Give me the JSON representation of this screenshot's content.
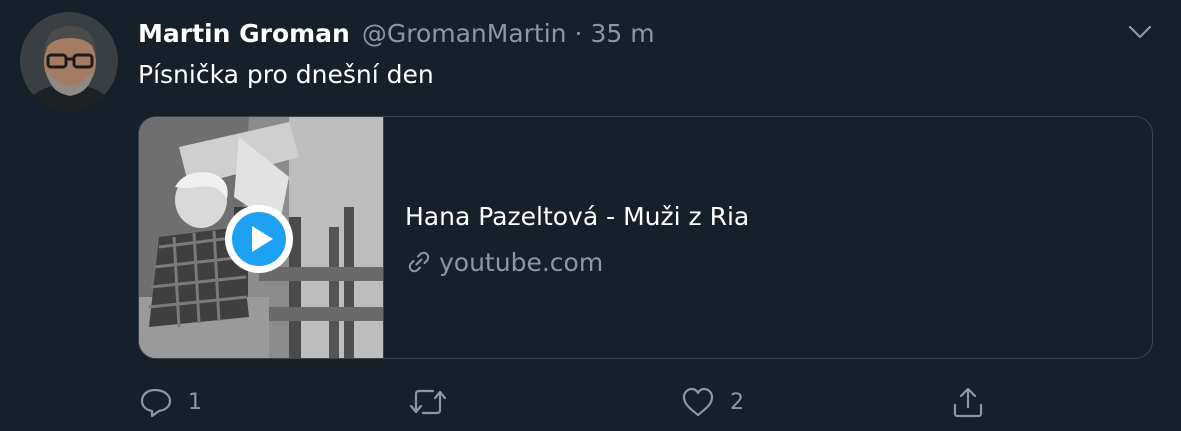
{
  "tweet": {
    "author": {
      "display_name": "Martin Groman",
      "handle": "@GromanMartin"
    },
    "separator": "·",
    "time": "35 m",
    "text": "Písnička pro dnešní den",
    "card": {
      "title": "Hana Pazeltová - Muži z Ria",
      "domain": "youtube.com"
    },
    "actions": {
      "reply_count": "1",
      "retweet_count": "",
      "like_count": "2"
    }
  },
  "colors": {
    "background": "#15202b",
    "text_primary": "#ffffff",
    "text_secondary": "#8899a6",
    "border": "#38444d",
    "play_accent": "#1da1f2"
  }
}
